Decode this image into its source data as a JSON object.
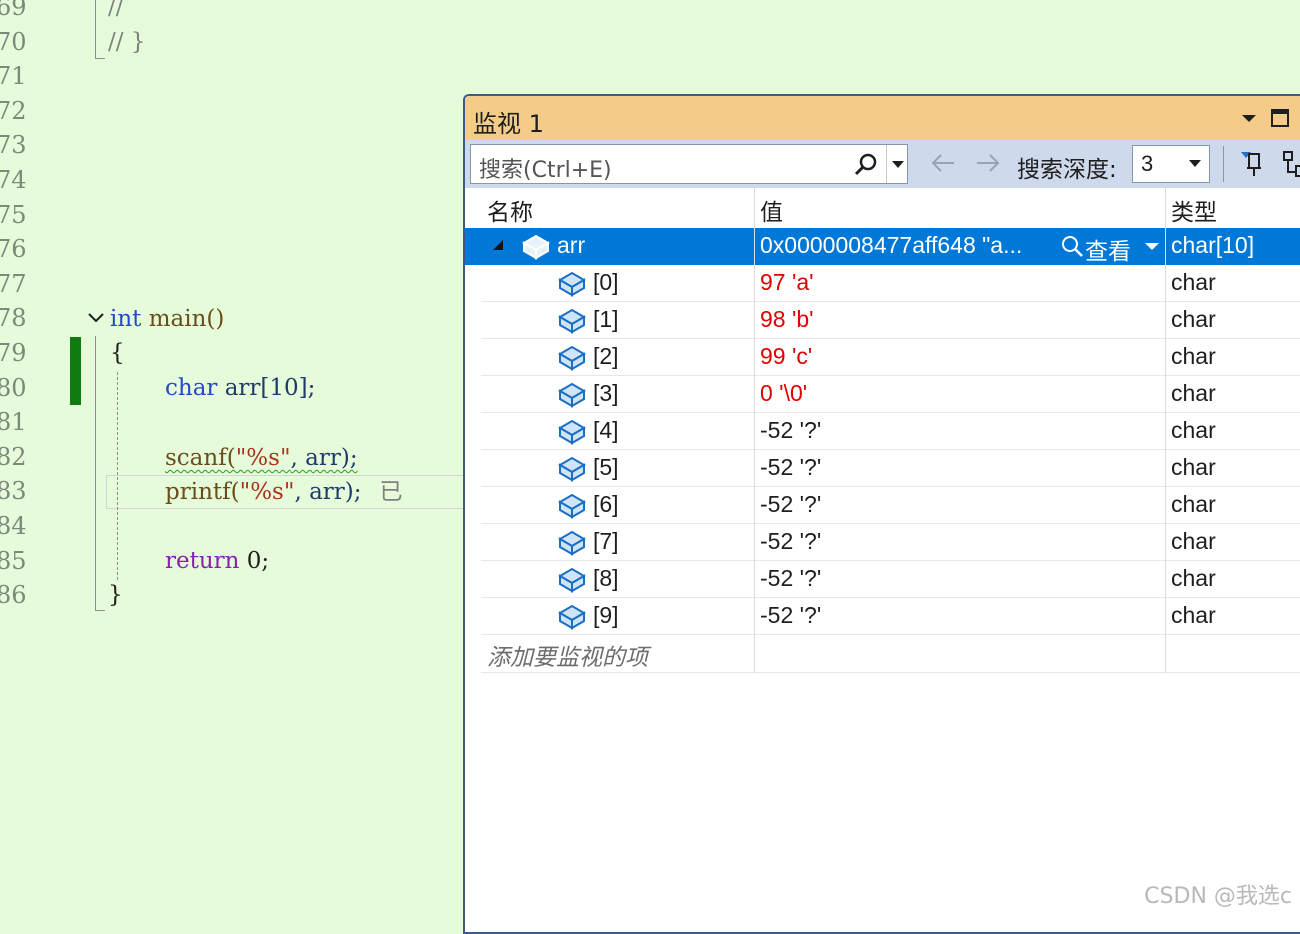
{
  "editor": {
    "lines": [
      {
        "num": "69",
        "text": "//"
      },
      {
        "num": "70",
        "text": "// }"
      },
      {
        "num": "71",
        "text": ""
      },
      {
        "num": "72",
        "text": ""
      },
      {
        "num": "73",
        "text": ""
      },
      {
        "num": "74",
        "text": ""
      },
      {
        "num": "75",
        "text": ""
      },
      {
        "num": "76",
        "text": ""
      },
      {
        "num": "77",
        "text": ""
      },
      {
        "num": "78",
        "text": "int main()"
      },
      {
        "num": "79",
        "text": "{"
      },
      {
        "num": "80",
        "text": "char arr[10];"
      },
      {
        "num": "81",
        "text": ""
      },
      {
        "num": "82",
        "text": "scanf(\"%s\", arr);"
      },
      {
        "num": "83",
        "text": "printf(\"%s\", arr);"
      },
      {
        "num": "84",
        "text": ""
      },
      {
        "num": "85",
        "text": "return 0;"
      },
      {
        "num": "86",
        "text": "}"
      }
    ],
    "tokens": {
      "cmt1": "//",
      "cmt2": "// }",
      "int_kw": "int",
      "main_fn": " main()",
      "brace_open": "{",
      "char_kw": "char",
      "arr_decl": " arr[10];",
      "scanf_fn": "scanf(",
      "scanf_str": "\"%s\"",
      "scanf_rest": ", arr);",
      "printf_fn": "printf(",
      "printf_str": "\"%s\"",
      "printf_rest": ", arr);",
      "elapsed_hint": "已",
      "return_kw": "return",
      "return_rest": " 0;",
      "brace_close": "}"
    }
  },
  "watch": {
    "title": "监视 1",
    "search_placeholder": "搜索(Ctrl+E)",
    "depth_label": "搜索深度:",
    "depth_value": "3",
    "columns": {
      "name": "名称",
      "value": "值",
      "type": "类型"
    },
    "root": {
      "name": "arr",
      "value": "0x0000008477aff648 \"a...",
      "view_label": "查看",
      "type": "char[10]"
    },
    "items": [
      {
        "name": "[0]",
        "value": "97 'a'",
        "type": "char",
        "changed": true
      },
      {
        "name": "[1]",
        "value": "98 'b'",
        "type": "char",
        "changed": true
      },
      {
        "name": "[2]",
        "value": "99 'c'",
        "type": "char",
        "changed": true
      },
      {
        "name": "[3]",
        "value": "0 '\\0'",
        "type": "char",
        "changed": true
      },
      {
        "name": "[4]",
        "value": "-52 '?'",
        "type": "char",
        "changed": false
      },
      {
        "name": "[5]",
        "value": "-52 '?'",
        "type": "char",
        "changed": false
      },
      {
        "name": "[6]",
        "value": "-52 '?'",
        "type": "char",
        "changed": false
      },
      {
        "name": "[7]",
        "value": "-52 '?'",
        "type": "char",
        "changed": false
      },
      {
        "name": "[8]",
        "value": "-52 '?'",
        "type": "char",
        "changed": false
      },
      {
        "name": "[9]",
        "value": "-52 '?'",
        "type": "char",
        "changed": false
      }
    ],
    "add_item_hint": "添加要监视的项"
  },
  "watermark": "CSDN @我选c",
  "colors": {
    "selection": "#0078d7",
    "changed_value": "#e00000",
    "titlebar": "#f5cb8a",
    "editor_bg": "#e5fbd9"
  }
}
